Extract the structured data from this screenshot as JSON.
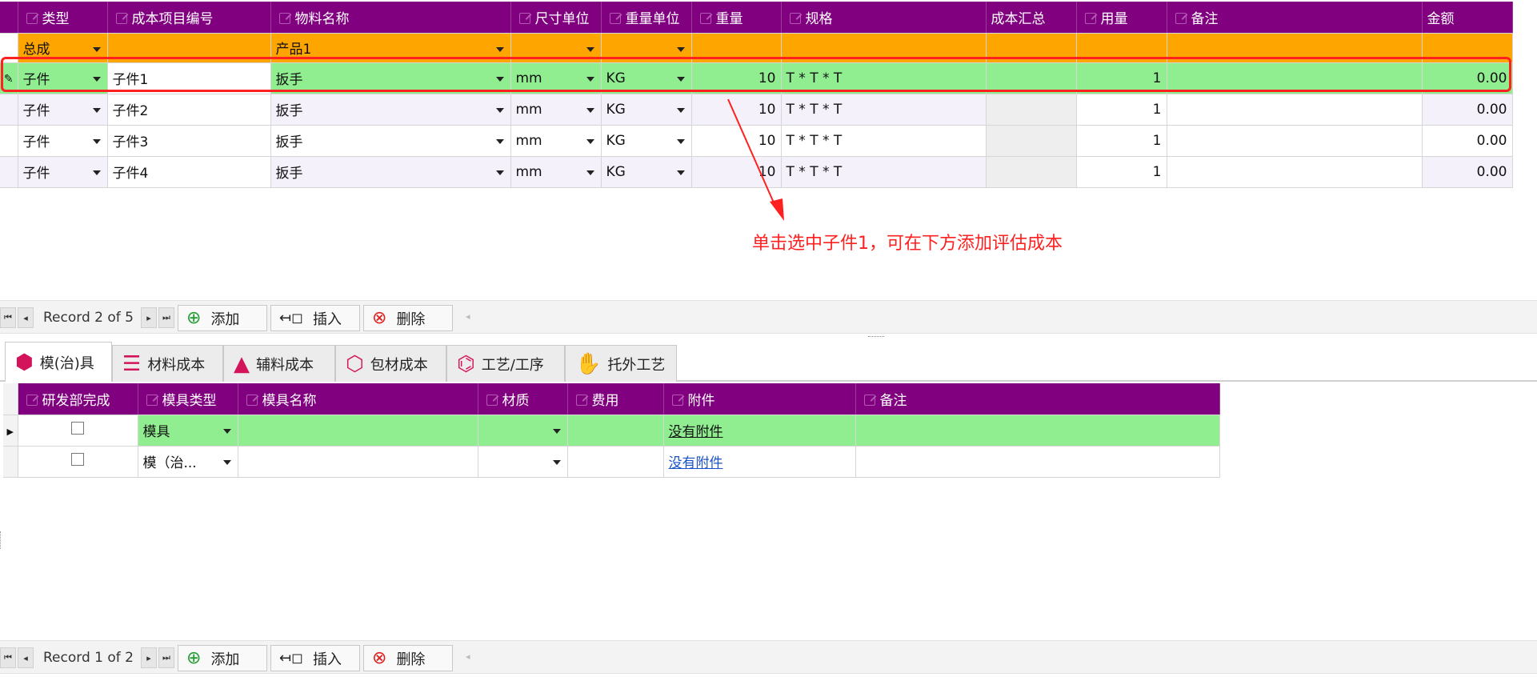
{
  "main_grid": {
    "columns": [
      "类型",
      "成本项目编号",
      "物料名称",
      "尺寸单位",
      "重量单位",
      "重量",
      "规格",
      "成本汇总",
      "用量",
      "备注",
      "金额"
    ],
    "total_row": {
      "type": "总成",
      "code": "",
      "material": "产品1",
      "size_unit": "",
      "weight_unit": "",
      "weight": "",
      "spec": "",
      "cost_sum": "",
      "qty": "",
      "note": "",
      "amount": ""
    },
    "rows": [
      {
        "type": "子件",
        "code": "子件1",
        "material": "扳手",
        "size_unit": "mm",
        "weight_unit": "KG",
        "weight": "10",
        "spec": "T * T * T",
        "cost_sum": "",
        "qty": "1",
        "note": "",
        "amount": "0.00"
      },
      {
        "type": "子件",
        "code": "子件2",
        "material": "扳手",
        "size_unit": "mm",
        "weight_unit": "KG",
        "weight": "10",
        "spec": "T * T * T",
        "cost_sum": "",
        "qty": "1",
        "note": "",
        "amount": "0.00"
      },
      {
        "type": "子件",
        "code": "子件3",
        "material": "扳手",
        "size_unit": "mm",
        "weight_unit": "KG",
        "weight": "10",
        "spec": "T * T * T",
        "cost_sum": "",
        "qty": "1",
        "note": "",
        "amount": "0.00"
      },
      {
        "type": "子件",
        "code": "子件4",
        "material": "扳手",
        "size_unit": "mm",
        "weight_unit": "KG",
        "weight": "10",
        "spec": "T * T * T",
        "cost_sum": "",
        "qty": "1",
        "note": "",
        "amount": "0.00"
      }
    ]
  },
  "annotation": "单击选中子件1，可在下方添加评估成本",
  "nav_top": {
    "record": "Record 2 of 5",
    "add": "添加",
    "insert": "插入",
    "delete": "删除"
  },
  "tabs": [
    {
      "label": "模(治)具",
      "icon": "cube-icon",
      "color": "#d4145a"
    },
    {
      "label": "材料成本",
      "icon": "stack-icon",
      "color": "#d4145a"
    },
    {
      "label": "辅料成本",
      "icon": "cone-icon",
      "color": "#d4145a"
    },
    {
      "label": "包材成本",
      "icon": "box-icon",
      "color": "#d4145a"
    },
    {
      "label": "工艺/工序",
      "icon": "process-icon",
      "color": "#d4145a"
    },
    {
      "label": "托外工艺",
      "icon": "hand-icon",
      "color": "#d4145a"
    }
  ],
  "sub_grid": {
    "columns": [
      "研发部完成",
      "模具类型",
      "模具名称",
      "材质",
      "费用",
      "附件",
      "备注"
    ],
    "rows": [
      {
        "done": false,
        "mold_type": "模具",
        "mold_name": "",
        "material": "",
        "fee": "",
        "attachment": "没有附件",
        "note": ""
      },
      {
        "done": false,
        "mold_type": "模（治...",
        "mold_name": "",
        "material": "",
        "fee": "",
        "attachment": "没有附件",
        "note": ""
      }
    ]
  },
  "nav_bottom": {
    "record": "Record 1 of 2",
    "add": "添加",
    "insert": "插入",
    "delete": "删除"
  },
  "colors": {
    "header": "#800080",
    "total": "#ffa500",
    "selected": "#90ee90",
    "annotation": "#ff2020"
  }
}
